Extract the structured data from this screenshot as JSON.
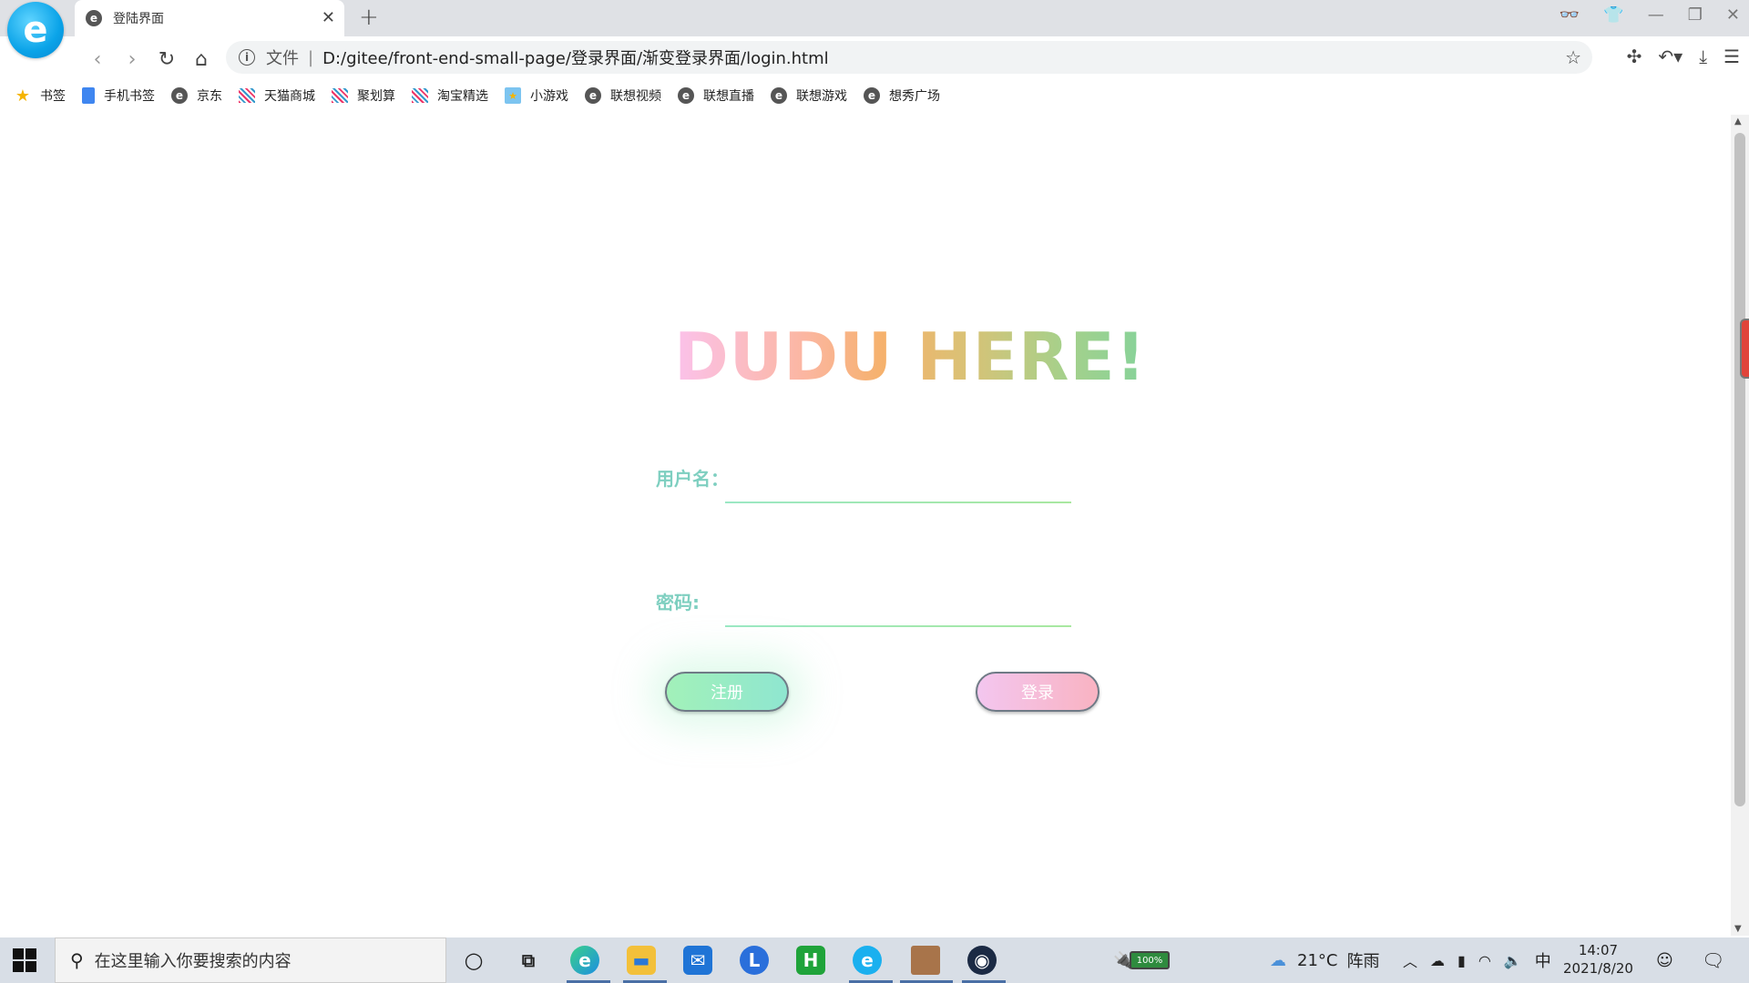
{
  "browser": {
    "logo_letter": "e",
    "tab": {
      "favicon": "e",
      "title": "登陆界面"
    },
    "new_tab_label": "+",
    "address": {
      "scheme": "文件",
      "separator": "|",
      "url": "D:/gitee/front-end-small-page/登录界面/渐变登录界面/login.html"
    },
    "bookmarks": [
      {
        "label": "书签",
        "icon": "star-icon"
      },
      {
        "label": "手机书签",
        "icon": "phone-icon"
      },
      {
        "label": "京东",
        "icon": "e-icon"
      },
      {
        "label": "天猫商城",
        "icon": "grid-icon"
      },
      {
        "label": "聚划算",
        "icon": "grid-icon"
      },
      {
        "label": "淘宝精选",
        "icon": "grid-icon"
      },
      {
        "label": "小游戏",
        "icon": "game-icon"
      },
      {
        "label": "联想视频",
        "icon": "e-icon"
      },
      {
        "label": "联想直播",
        "icon": "e-icon"
      },
      {
        "label": "联想游戏",
        "icon": "e-icon"
      },
      {
        "label": "想秀广场",
        "icon": "e-icon"
      }
    ]
  },
  "page": {
    "headline": "DUDU HERE!",
    "username_label": "用户名：",
    "password_label": "密码:",
    "username_value": "",
    "password_value": "",
    "register_button": "注册",
    "login_button": "登录",
    "colors": {
      "label": "#7ecfc0",
      "register_gradient": [
        "#a2f1b9",
        "#8fe6d0"
      ],
      "login_gradient": [
        "#f3c6ef",
        "#f9b3c2"
      ]
    }
  },
  "taskbar": {
    "search_placeholder": "在这里输入你要搜索的内容",
    "battery": "100%",
    "weather_temp": "21°C",
    "weather_text": "阵雨",
    "ime": "中",
    "time": "14:07",
    "date": "2021/8/20"
  }
}
